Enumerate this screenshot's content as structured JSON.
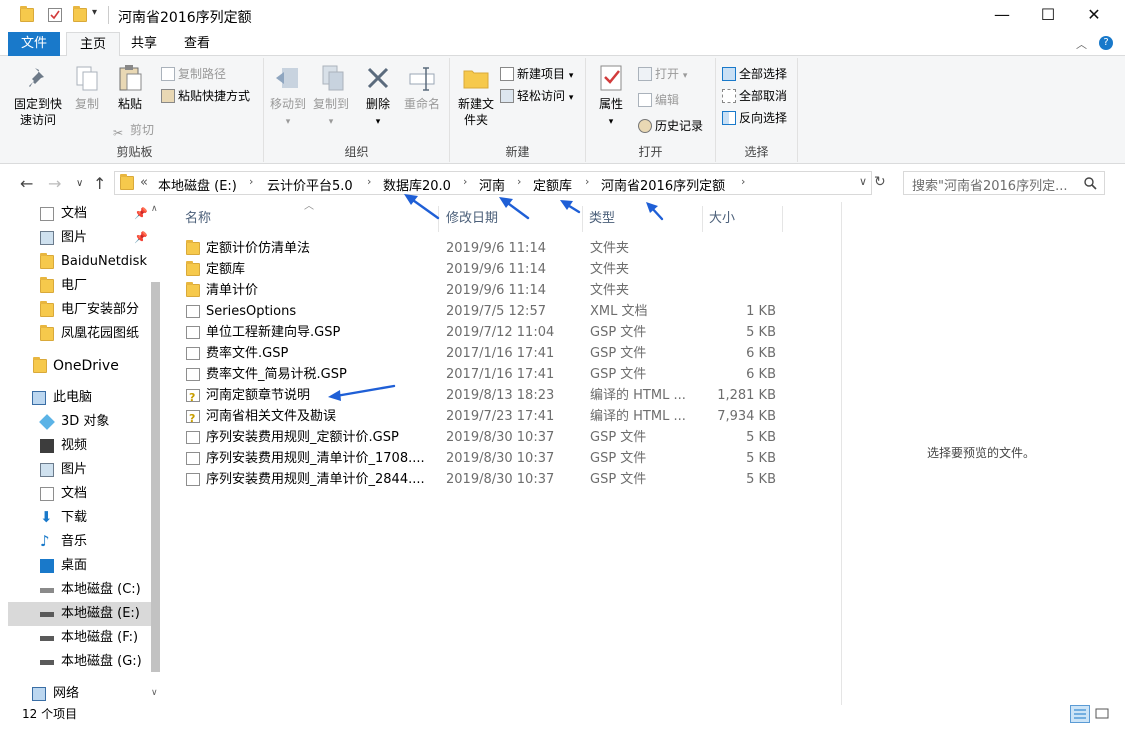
{
  "window": {
    "title": "河南省2016序列定额",
    "controls": {
      "minimize": "—",
      "maximize": "☐",
      "close": "✕"
    }
  },
  "tabs": [
    "文件",
    "主页",
    "共享",
    "查看"
  ],
  "ribbon": {
    "clipboard": {
      "label": "剪贴板",
      "pin_label": "固定到快速访问",
      "copy_label": "复制",
      "paste_label": "粘贴",
      "copy_path": "复制路径",
      "paste_shortcut": "粘贴快捷方式",
      "cut": "剪切"
    },
    "organize": {
      "label": "组织",
      "move_to": "移动到",
      "copy_to": "复制到",
      "delete": "删除",
      "rename": "重命名"
    },
    "new": {
      "label": "新建",
      "new_folder": "新建文件夹",
      "new_item": "新建项目",
      "easy_access": "轻松访问"
    },
    "open": {
      "label": "打开",
      "properties": "属性",
      "open": "打开",
      "edit": "编辑",
      "history": "历史记录"
    },
    "select": {
      "label": "选择",
      "select_all": "全部选择",
      "select_none": "全部取消",
      "invert": "反向选择"
    }
  },
  "address": {
    "overflow": "«",
    "crumbs": [
      "本地磁盘 (E:)",
      "云计价平台5.0",
      "数据库20.0",
      "河南",
      "定额库",
      "河南省2016序列定额"
    ]
  },
  "search": {
    "placeholder": "搜索\"河南省2016序列定..."
  },
  "nav": {
    "quick_access": [
      {
        "label": "文档",
        "icon": "document-icon",
        "pinned": true
      },
      {
        "label": "图片",
        "icon": "picture-icon",
        "pinned": true
      },
      {
        "label": "BaiduNetdisk",
        "icon": "folder-icon",
        "pinned": false
      },
      {
        "label": "电厂",
        "icon": "folder-icon",
        "pinned": false
      },
      {
        "label": "电厂安装部分",
        "icon": "folder-icon",
        "pinned": false
      },
      {
        "label": "凤凰花园图纸",
        "icon": "folder-icon",
        "pinned": false
      }
    ],
    "onedrive": "OneDrive",
    "this_pc": "此电脑",
    "pc_items": [
      {
        "label": "3D 对象",
        "icon": "3d-objects-icon"
      },
      {
        "label": "视频",
        "icon": "video-icon"
      },
      {
        "label": "图片",
        "icon": "picture-icon"
      },
      {
        "label": "文档",
        "icon": "document-icon"
      },
      {
        "label": "下载",
        "icon": "download-icon"
      },
      {
        "label": "音乐",
        "icon": "music-icon"
      },
      {
        "label": "桌面",
        "icon": "desktop-icon"
      },
      {
        "label": "本地磁盘 (C:)",
        "icon": "drive-icon"
      },
      {
        "label": "本地磁盘 (E:)",
        "icon": "drive-icon",
        "selected": true
      },
      {
        "label": "本地磁盘 (F:)",
        "icon": "drive-icon"
      },
      {
        "label": "本地磁盘 (G:)",
        "icon": "drive-icon"
      }
    ],
    "network": "网络"
  },
  "columns": {
    "name": "名称",
    "date": "修改日期",
    "type": "类型",
    "size": "大小"
  },
  "files": [
    {
      "name": "定额计价仿清单法",
      "date": "2019/9/6 11:14",
      "type": "文件夹",
      "size": "",
      "icon": "folder"
    },
    {
      "name": "定额库",
      "date": "2019/9/6 11:14",
      "type": "文件夹",
      "size": "",
      "icon": "folder"
    },
    {
      "name": "清单计价",
      "date": "2019/9/6 11:14",
      "type": "文件夹",
      "size": "",
      "icon": "folder"
    },
    {
      "name": "SeriesOptions",
      "date": "2019/7/5 12:57",
      "type": "XML 文档",
      "size": "1 KB",
      "icon": "doc"
    },
    {
      "name": "单位工程新建向导.GSP",
      "date": "2019/7/12 11:04",
      "type": "GSP 文件",
      "size": "5 KB",
      "icon": "doc"
    },
    {
      "name": "费率文件.GSP",
      "date": "2017/1/16 17:41",
      "type": "GSP 文件",
      "size": "6 KB",
      "icon": "doc"
    },
    {
      "name": "费率文件_简易计税.GSP",
      "date": "2017/1/16 17:41",
      "type": "GSP 文件",
      "size": "6 KB",
      "icon": "doc"
    },
    {
      "name": "河南定额章节说明",
      "date": "2019/8/13 18:23",
      "type": "编译的 HTML ...",
      "size": "1,281 KB",
      "icon": "chm"
    },
    {
      "name": "河南省相关文件及勘误",
      "date": "2019/7/23 17:41",
      "type": "编译的 HTML ...",
      "size": "7,934 KB",
      "icon": "chm"
    },
    {
      "name": "序列安装费用规则_定额计价.GSP",
      "date": "2019/8/30 10:37",
      "type": "GSP 文件",
      "size": "5 KB",
      "icon": "doc"
    },
    {
      "name": "序列安装费用规则_清单计价_1708....",
      "date": "2019/8/30 10:37",
      "type": "GSP 文件",
      "size": "5 KB",
      "icon": "doc"
    },
    {
      "name": "序列安装费用规则_清单计价_2844....",
      "date": "2019/8/30 10:37",
      "type": "GSP 文件",
      "size": "5 KB",
      "icon": "doc"
    }
  ],
  "preview": {
    "message": "选择要预览的文件。"
  },
  "status": {
    "count": "12 个项目"
  },
  "colors": {
    "accent": "#1979ca",
    "folder": "#f6c94c",
    "annotation": "#1f5fd6"
  }
}
